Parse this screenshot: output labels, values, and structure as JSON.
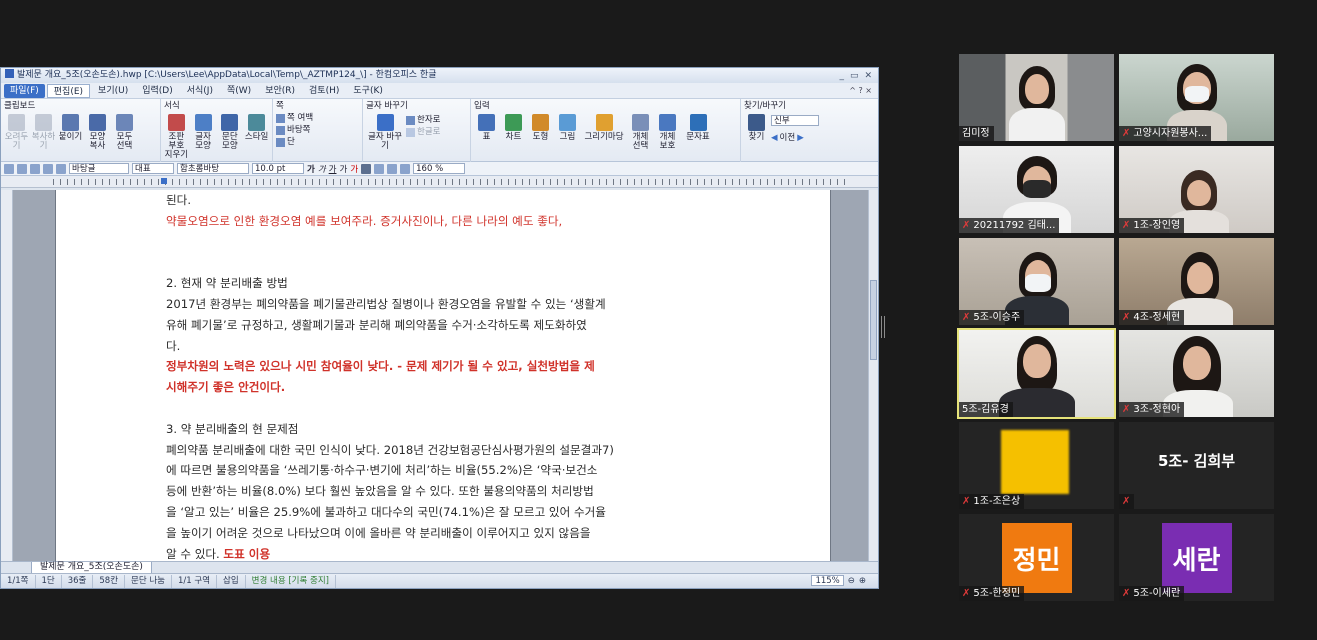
{
  "window": {
    "title": "발제문 개요_5조(오손도손).hwp [C:\\Users\\Lee\\AppData\\Local\\Temp\\_AZTMP124_\\] - 한컴오피스 한글",
    "controls": [
      "_",
      "▭",
      "✕"
    ]
  },
  "menu": {
    "items": [
      "파일(F)",
      "편집(E)",
      "보기(U)",
      "입력(D)",
      "서식(J)",
      "쪽(W)",
      "보안(R)",
      "검토(H)",
      "도구(K)"
    ],
    "right": "^ ? ×"
  },
  "ribbon": {
    "groups": [
      {
        "title": "클립보드",
        "buttons": [
          "오려두기",
          "복사하기",
          "붙이기",
          "모양 복사",
          "모두 선택"
        ]
      },
      {
        "title": "서식",
        "buttons": [
          "조판 부호 지우기",
          "글자 모양",
          "문단 모양",
          "스타일"
        ]
      },
      {
        "title": "쪽",
        "items": [
          "쪽 여백",
          "바탕쪽",
          "단"
        ]
      },
      {
        "title": "글자 바꾸기",
        "items": [
          "글자 바꾸기",
          "한자로",
          "한글로"
        ]
      },
      {
        "title": "입력",
        "buttons": [
          "표",
          "차트",
          "도형",
          "그림",
          "그리기마당",
          "개체 선택",
          "개체 보호",
          "문자표"
        ]
      },
      {
        "title": "찾기/바꾸기",
        "buttons": [
          "찾기"
        ],
        "search_value": "신부",
        "prev_label": "이전"
      }
    ]
  },
  "format_bar": {
    "style": "바탕글",
    "lang": "대표",
    "font": "함초롬바탕",
    "size": "10.0 pt",
    "chars": [
      "가",
      "가",
      "가",
      "가",
      "가"
    ],
    "zoom": "160 %"
  },
  "document": {
    "lines": [
      {
        "text": "된다.",
        "style": "normal"
      },
      {
        "text": "약물오염으로 인한 환경오염 예를 보여주라. 증거사진이나, 다른 나라의 예도 좋다,",
        "style": "red"
      },
      {
        "text": "",
        "style": "gap"
      },
      {
        "text": "",
        "style": "gap"
      },
      {
        "text": "2. 현재 약 분리배출 방법",
        "style": "normal"
      },
      {
        "text": "2017년 환경부는 폐의약품을 폐기물관리법상 질병이나 환경오염을 유발할 수 있는 ‘생활계",
        "style": "normal"
      },
      {
        "text": "유해 폐기물’로 규정하고, 생활폐기물과 분리해 폐의약품을 수거·소각하도록 제도화하였",
        "style": "normal"
      },
      {
        "text": "다.",
        "style": "normal"
      },
      {
        "text": "정부차원의 노력은 있으나 시민 참여율이 낮다. - 문제 제기가 될 수 있고, 실천방법을 제",
        "style": "redb"
      },
      {
        "text": "시해주기 좋은 안건이다.",
        "style": "redb"
      },
      {
        "text": "",
        "style": "gap"
      },
      {
        "text": "3. 약 분리배출의 현 문제점",
        "style": "normal"
      },
      {
        "text": "폐의약품 분리배출에 대한 국민 인식이 낮다. 2018년 건강보험공단심사평가원의 설문결과7)",
        "style": "normal"
      },
      {
        "text": "에 따르면 불용의약품을 ‘쓰레기통·하수구·변기에 처리’하는 비율(55.2%)은 ‘약국·보건소",
        "style": "normal"
      },
      {
        "text": "등에 반환’하는 비율(8.0%) 보다 훨씬 높았음을 알 수 있다. 또한 불용의약품의 처리방법",
        "style": "normal"
      },
      {
        "text": "을 ‘알고 있는’ 비율은 25.9%에 불과하고 대다수의 국민(74.1%)은 잘 모르고 있어 수거율",
        "style": "normal"
      },
      {
        "text": "을 높이기 어려운 것으로 나타났으며 이에 올바른 약 분리배출이 이루어지고 있지 않음을",
        "style": "normal"
      }
    ],
    "last_line_text": "알 수 있다.",
    "last_line_red": "도표 이용"
  },
  "doc_tab": "발제문 개요_5조(오손도손)",
  "status": {
    "cells": [
      "1/1쪽",
      "1단",
      "36줄",
      "58칸",
      "문단 나눔",
      "1/1 구역",
      "삽입"
    ],
    "track": "변경 내용 [기록 중지]",
    "zoom": "115%"
  },
  "participants": [
    {
      "name": "김미정",
      "muted": false
    },
    {
      "name": "고양시자원봉사...",
      "muted": true
    },
    {
      "name": "20211792 김태...",
      "muted": true
    },
    {
      "name": "1조-장인영",
      "muted": true
    },
    {
      "name": "5조-이승주",
      "muted": true
    },
    {
      "name": "4조-정세현",
      "muted": true
    },
    {
      "name": "5조-김유경",
      "muted": false
    },
    {
      "name": "3조-정현아",
      "muted": true
    },
    {
      "name": "1조-조은상",
      "muted": true
    },
    {
      "name": "5조- 김희부",
      "muted": true
    },
    {
      "name": "5조-한정민",
      "muted": true,
      "initials": "정민",
      "color": "#f07a10"
    },
    {
      "name": "5조-이세란",
      "muted": true,
      "initials": "세란",
      "color": "#7a2db2"
    }
  ],
  "colors": {
    "accent": "#3b6fc7",
    "speaking": "#e6e37a",
    "muted": "#e03a3a"
  }
}
